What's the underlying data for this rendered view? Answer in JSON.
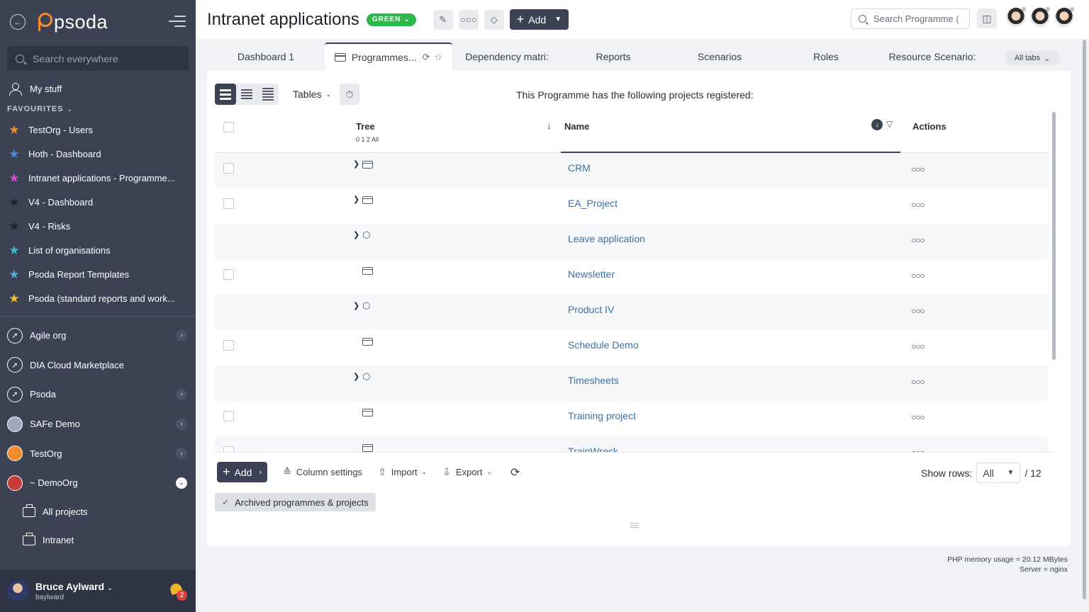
{
  "sidebar": {
    "search_placeholder": "Search everywhere",
    "my_stuff": "My stuff",
    "favourites_label": "FAVOURITES",
    "favourites": [
      {
        "label": "TestOrg - Users",
        "color": "#f28b2e"
      },
      {
        "label": "Hoth - Dashboard",
        "color": "#4c8ddb"
      },
      {
        "label": "Intranet applications - Programme...",
        "color": "#d14fd1"
      },
      {
        "label": "V4 - Dashboard",
        "color": "#1e2230"
      },
      {
        "label": "V4 - Risks",
        "color": "#1e2230"
      },
      {
        "label": "List of organisations",
        "color": "#3fb8d8"
      },
      {
        "label": "Psoda Report Templates",
        "color": "#4cb0d8"
      },
      {
        "label": "Psoda (standard reports and work...",
        "color": "#f2c230"
      }
    ],
    "orgs": [
      {
        "label": "Agile org",
        "icon": "rocket-icon",
        "bg": "#3c4254",
        "arrow": true
      },
      {
        "label": "DIA Cloud Marketplace",
        "icon": "rocket-icon",
        "bg": "#3c4254",
        "arrow": false
      },
      {
        "label": "Psoda",
        "icon": "rocket-icon",
        "bg": "#3c4254",
        "arrow": true
      },
      {
        "label": "SAFe Demo",
        "icon": "globe-icon",
        "bg": "#9fa9bc",
        "arrow": true
      },
      {
        "label": "TestOrg",
        "icon": "orange-logo-icon",
        "bg": "#f28b2e",
        "arrow": true
      },
      {
        "label": "~ DemoOrg",
        "icon": "red-logo-icon",
        "bg": "#c93a3a",
        "arrow": true,
        "open": true
      }
    ],
    "sub_items": [
      {
        "label": "All projects"
      },
      {
        "label": "Intranet"
      }
    ],
    "user": {
      "name": "Bruce Aylward",
      "login": "baylward",
      "notifications": "2"
    }
  },
  "header": {
    "title": "Intranet applications",
    "status": "GREEN",
    "add_label": "Add",
    "search_placeholder": "Search Programme (",
    "avatar_count": 3
  },
  "tabs": [
    {
      "label": "Dashboard 1",
      "active": false
    },
    {
      "label": "Programmes...",
      "active": true
    },
    {
      "label": "Dependency matri:",
      "active": false
    },
    {
      "label": "Reports",
      "active": false
    },
    {
      "label": "Scenarios",
      "active": false
    },
    {
      "label": "Roles",
      "active": false
    },
    {
      "label": "Resource Scenario:",
      "active": false
    }
  ],
  "all_tabs_label": "All tabs",
  "toolbar": {
    "tables_label": "Tables",
    "intro_text": "This Programme has the following projects registered:"
  },
  "grid": {
    "columns": {
      "tree": "Tree",
      "tree_levels": "0 1 2 All",
      "name": "Name",
      "actions": "Actions"
    },
    "rows": [
      {
        "name": "CRM",
        "expandable": true,
        "type": "programme",
        "checkbox": true
      },
      {
        "name": "EA_Project",
        "expandable": true,
        "type": "programme",
        "checkbox": true
      },
      {
        "name": "Leave application",
        "expandable": true,
        "type": "cube",
        "checkbox": false
      },
      {
        "name": "Newsletter",
        "expandable": false,
        "type": "programme",
        "checkbox": true
      },
      {
        "name": "Product IV",
        "expandable": true,
        "type": "cube",
        "checkbox": false
      },
      {
        "name": "Schedule Demo",
        "expandable": false,
        "type": "programme",
        "checkbox": true
      },
      {
        "name": "Timesheets",
        "expandable": true,
        "type": "cube",
        "checkbox": false
      },
      {
        "name": "Training project",
        "expandable": false,
        "type": "programme",
        "checkbox": true
      },
      {
        "name": "TrainWreck",
        "expandable": false,
        "type": "programme",
        "checkbox": true
      }
    ]
  },
  "footer": {
    "add_label": "Add",
    "column_settings": "Column settings",
    "import": "Import",
    "export": "Export",
    "show_rows_label": "Show rows:",
    "show_rows_value": "All",
    "total": "/ 12",
    "archived": "Archived programmes & projects"
  },
  "memory": {
    "php": "PHP memory usage = 20.12 MBytes",
    "server": "Server = nginx"
  }
}
